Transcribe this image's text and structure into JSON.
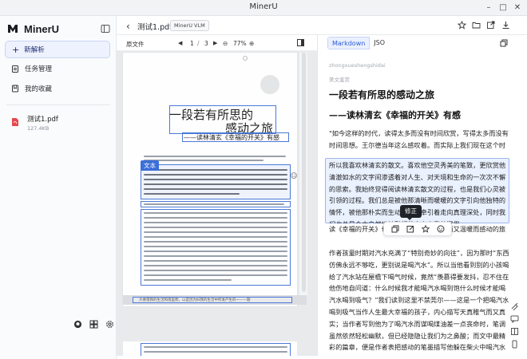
{
  "window": {
    "title": "MinerU"
  },
  "sidebar": {
    "logo_text": "MinerU",
    "new_label": "新解析",
    "items": [
      {
        "label": "任务管理",
        "icon": "clipboard-icon"
      },
      {
        "label": "我的收藏",
        "icon": "bookmark-icon"
      }
    ],
    "file": {
      "name": "测试1.pdf",
      "size": "127.4KB"
    },
    "bottom_icons": [
      "github-icon",
      "grid-icon",
      "settings-icon"
    ]
  },
  "header": {
    "doc_title": "测试1.pdf",
    "model_badge": "MinerU VLM"
  },
  "pdf_toolbar": {
    "label": "原文件",
    "page_current": "1",
    "page_sep": "/",
    "page_total": "3",
    "zoom": "77%"
  },
  "pdf_page": {
    "title_line1": "一段若有所思的",
    "title_line2": "感动之旅",
    "subtitle": "——读林清玄《幸福的开关》有感",
    "tag": "文本",
    "footer_text": "大要落我的生活和雨里爬，以是因为妇我的生活中所发产生的一——题"
  },
  "right_toolbar": {
    "tabs": [
      "Markdown",
      "JSON"
    ],
    "active_tab": "Markdown"
  },
  "markdown": {
    "faint1": "zhongxueshengshidai",
    "faint2": "美文鉴赏",
    "h1": "一段若有所思的感动之旅",
    "h2": "——读林清玄《幸福的开关》有感",
    "p1": "\"如今这样的时代，读得太多而没有时间欣赏，写得太多而没有时间思想。王尔德当年这么感叹着。而实际上我们现在这个时代何尝不是这样呢？",
    "p2": "所以我喜欢林清玄的散文。喜欢他空灵秀美的笔致，更欣赏他清澈如水的文字间渗透着对人生、对天境和生命的一次次不懈的思索。我始终觉得阅读林清玄散文的过程，也是我们心灵被引领的过程。我们总是被他那清晰而暖暖的文字引向他独特的情怀，被他那朴实而生动的文字牵引着走向真理深处，同时我们也总是会由自然地被引领着走向自我的深思。",
    "p3": "读《幸福的开关》也是这样一段若有所思而又温暖而感动的旅程。",
    "p4": "作者孩童时期对汽水充满了“特别奇妙的向往”，因为那时“东西仿佛永远不够吃，更别说是喝汽水”。所以当他看到别的小孩喝给了汽水站在屋檐下喝气时候，竟然“羡慕得要发抖，忍不住在他伤地自问道：什么时候我才能喝汽水喝到饱什么时候才能喝汽水喝到吸气？”我们读到这里不禁莞尔——这是一个把喝汽水喝到吸气当作人生最大幸福的孩子，内心描写天真稚气而又真实；当作者写到他为了喝汽水而谋喝煤油差一点丧命时，笔调虽然依然轻松幽默，但已经隐隐让我们为之鼻酸；而文中最精彩的篇章，便是作者表把感动的笔墨描写他躲在柴火中喝汽水的情形，“我把整瓶汽水",
    "tooltip": "修正"
  },
  "colors": {
    "accent": "#3b6fd9",
    "selection": "#eaf1ff"
  }
}
